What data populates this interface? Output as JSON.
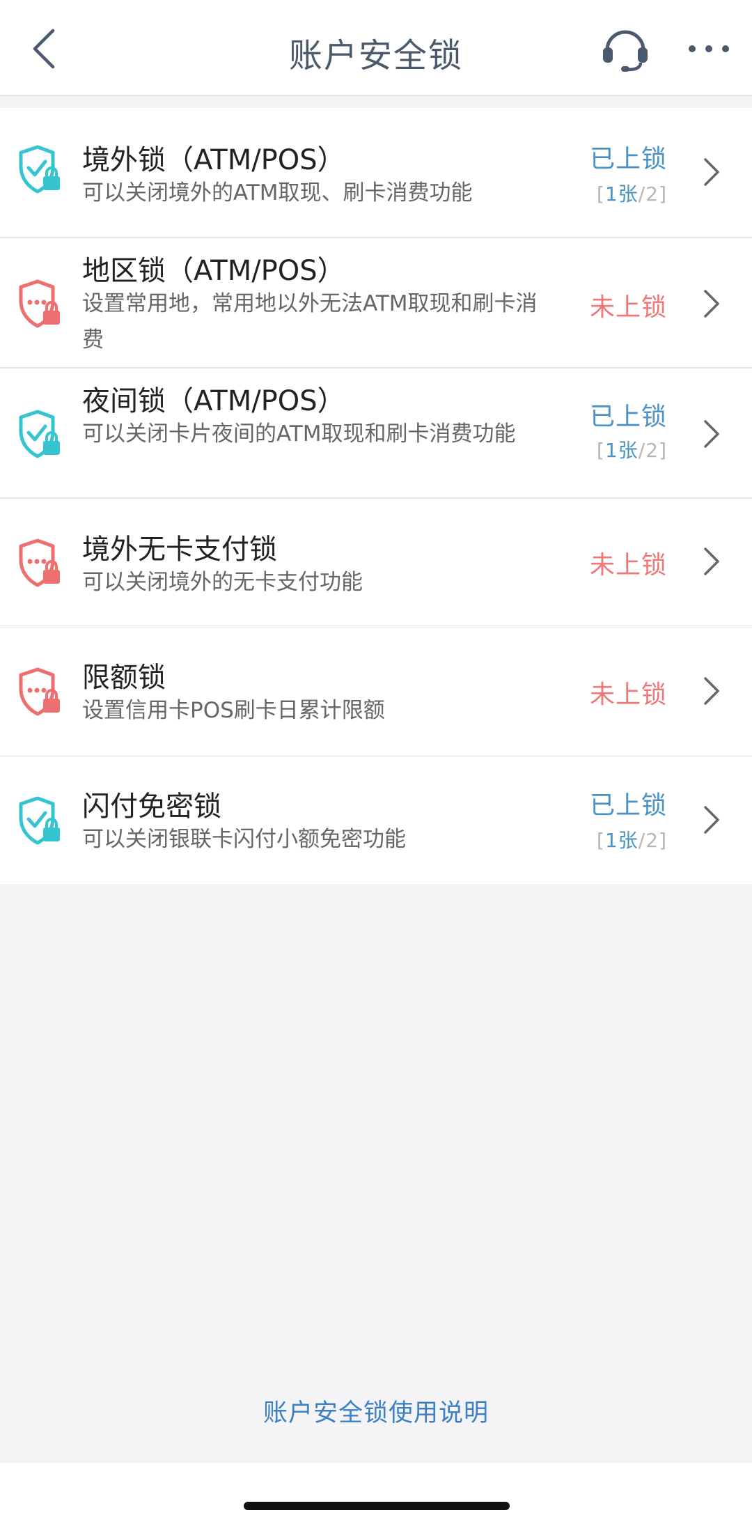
{
  "header": {
    "title": "账户安全锁"
  },
  "locks_group1": [
    {
      "title": "境外锁（ATM/POS）",
      "desc": "可以关闭境外的ATM取现、刷卡消费功能",
      "status": "已上锁",
      "state": "locked",
      "count_num": "1张",
      "count_total": "2"
    },
    {
      "title": "地区锁（ATM/POS）",
      "desc": "设置常用地，常用地以外无法ATM取现和刷卡消费",
      "status": "未上锁",
      "state": "unlocked"
    },
    {
      "title": "夜间锁（ATM/POS）",
      "desc": "可以关闭卡片夜间的ATM取现和刷卡消费功能",
      "status": "已上锁",
      "state": "locked",
      "count_num": "1张",
      "count_total": "2"
    },
    {
      "title": "境外无卡支付锁",
      "desc": "可以关闭境外的无卡支付功能",
      "status": "未上锁",
      "state": "unlocked"
    }
  ],
  "locks_group2": [
    {
      "title": "限额锁",
      "desc": "设置信用卡POS刷卡日累计限额",
      "status": "未上锁",
      "state": "unlocked"
    }
  ],
  "locks_group3": [
    {
      "title": "闪付免密锁",
      "desc": "可以关闭银联卡闪付小额免密功能",
      "status": "已上锁",
      "state": "locked",
      "count_num": "1张",
      "count_total": "2"
    }
  ],
  "footer": {
    "link": "账户安全锁使用说明"
  },
  "colors": {
    "locked": "#4a91c6",
    "unlocked": "#ee7777",
    "locked_icon": "#36c5d0",
    "unlocked_icon": "#ee6f70"
  },
  "icons": {
    "locked": "shield-check-lock-icon",
    "unlocked": "shield-dots-lock-icon"
  }
}
